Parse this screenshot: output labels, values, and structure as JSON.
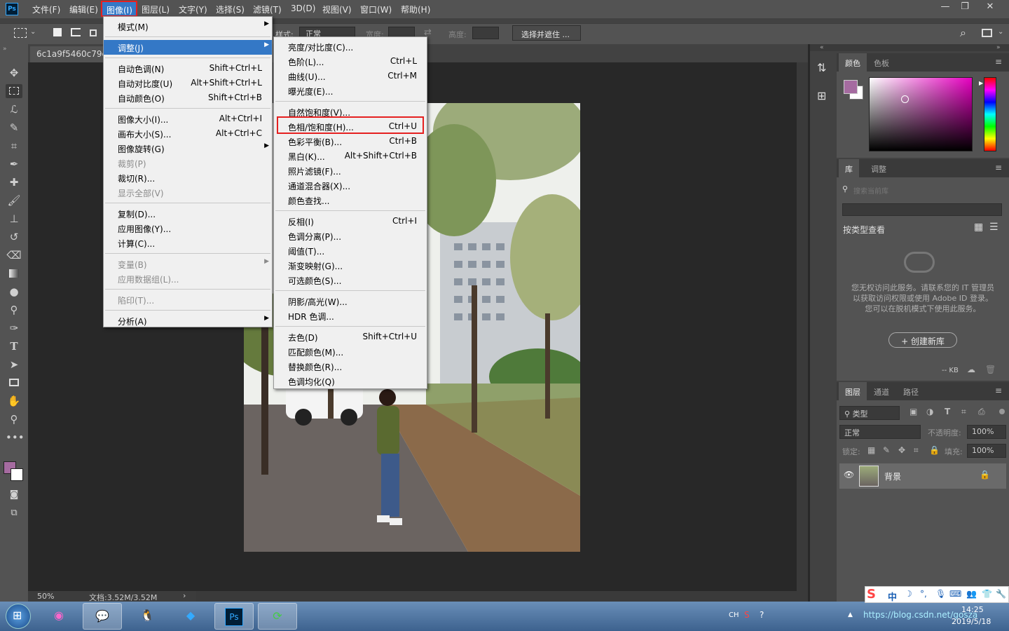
{
  "menubar": {
    "logo": "Ps",
    "items": [
      "文件(F)",
      "编辑(E)",
      "图像(I)",
      "图层(L)",
      "文字(Y)",
      "选择(S)",
      "滤镜(T)",
      "3D(D)",
      "视图(V)",
      "窗口(W)",
      "帮助(H)"
    ],
    "window_controls": [
      "—",
      "❐",
      "✕"
    ]
  },
  "options_bar": {
    "style_label": "样式:",
    "style_value": "正常",
    "width_label": "宽度:",
    "height_label": "高度:",
    "select_mask_button": "选择并遮住 ..."
  },
  "document": {
    "tab_title": "6c1a9f5460c79c",
    "zoom": "50%",
    "doc_info": "文档:3.52M/3.52M"
  },
  "image_menu": {
    "items": [
      {
        "label": "模式(M)",
        "shortcut": "",
        "submenu": true,
        "disabled": false
      },
      {
        "label": "调整(J)",
        "shortcut": "",
        "submenu": true,
        "disabled": false,
        "highlighted": true
      },
      {
        "label": "自动色调(N)",
        "shortcut": "Shift+Ctrl+L"
      },
      {
        "label": "自动对比度(U)",
        "shortcut": "Alt+Shift+Ctrl+L"
      },
      {
        "label": "自动颜色(O)",
        "shortcut": "Shift+Ctrl+B"
      },
      {
        "label": "图像大小(I)...",
        "shortcut": "Alt+Ctrl+I"
      },
      {
        "label": "画布大小(S)...",
        "shortcut": "Alt+Ctrl+C"
      },
      {
        "label": "图像旋转(G)",
        "shortcut": "",
        "submenu": true
      },
      {
        "label": "裁剪(P)",
        "shortcut": "",
        "disabled": true
      },
      {
        "label": "裁切(R)...",
        "shortcut": ""
      },
      {
        "label": "显示全部(V)",
        "shortcut": "",
        "disabled": true
      },
      {
        "label": "复制(D)...",
        "shortcut": ""
      },
      {
        "label": "应用图像(Y)...",
        "shortcut": ""
      },
      {
        "label": "计算(C)...",
        "shortcut": ""
      },
      {
        "label": "变量(B)",
        "shortcut": "",
        "submenu": true,
        "disabled": true
      },
      {
        "label": "应用数据组(L)...",
        "shortcut": "",
        "disabled": true
      },
      {
        "label": "陷印(T)...",
        "shortcut": "",
        "disabled": true
      },
      {
        "label": "分析(A)",
        "shortcut": "",
        "submenu": true
      }
    ]
  },
  "adjust_menu": {
    "items": [
      {
        "label": "亮度/对比度(C)...",
        "shortcut": ""
      },
      {
        "label": "色阶(L)...",
        "shortcut": "Ctrl+L"
      },
      {
        "label": "曲线(U)...",
        "shortcut": "Ctrl+M"
      },
      {
        "label": "曝光度(E)...",
        "shortcut": ""
      },
      {
        "label": "自然饱和度(V)...",
        "shortcut": ""
      },
      {
        "label": "色相/饱和度(H)...",
        "shortcut": "Ctrl+U",
        "boxed": true
      },
      {
        "label": "色彩平衡(B)...",
        "shortcut": "Ctrl+B"
      },
      {
        "label": "黑白(K)...",
        "shortcut": "Alt+Shift+Ctrl+B"
      },
      {
        "label": "照片滤镜(F)...",
        "shortcut": ""
      },
      {
        "label": "通道混合器(X)...",
        "shortcut": ""
      },
      {
        "label": "颜色查找...",
        "shortcut": ""
      },
      {
        "label": "反相(I)",
        "shortcut": "Ctrl+I"
      },
      {
        "label": "色调分离(P)...",
        "shortcut": ""
      },
      {
        "label": "阈值(T)...",
        "shortcut": ""
      },
      {
        "label": "渐变映射(G)...",
        "shortcut": ""
      },
      {
        "label": "可选颜色(S)...",
        "shortcut": ""
      },
      {
        "label": "阴影/高光(W)...",
        "shortcut": ""
      },
      {
        "label": "HDR 色调...",
        "shortcut": ""
      },
      {
        "label": "去色(D)",
        "shortcut": "Shift+Ctrl+U"
      },
      {
        "label": "匹配颜色(M)...",
        "shortcut": ""
      },
      {
        "label": "替换颜色(R)...",
        "shortcut": ""
      },
      {
        "label": "色调均化(Q)",
        "shortcut": ""
      }
    ]
  },
  "color_panel": {
    "tabs": [
      "颜色",
      "色板"
    ],
    "foreground": "#a56ba0",
    "background": "#ffffff",
    "hue_color": "#e600c0"
  },
  "library_panel": {
    "tabs": [
      "库",
      "调整"
    ],
    "search_placeholder": "搜索当前库",
    "view_by": "按类型查看",
    "message": "您无权访问此服务。请联系您的 IT 管理员以获取访问权限或使用 Adobe ID 登录。您可以在脱机模式下使用此服务。",
    "create_button": "+ 创建新库",
    "size": "-- KB"
  },
  "layers_panel": {
    "tabs": [
      "图层",
      "通道",
      "路径"
    ],
    "filter_label": "类型",
    "blend_mode": "正常",
    "opacity_label": "不透明度:",
    "opacity_value": "100%",
    "lock_label": "锁定:",
    "fill_label": "填充:",
    "fill_value": "100%",
    "layers": [
      {
        "name": "背景",
        "locked": true,
        "visible": true
      }
    ]
  },
  "taskbar": {
    "time": "14:25",
    "date": "2019/5/18",
    "lang": "CH",
    "ime": "中",
    "ps_label": "Ps",
    "watermark": "https://blog.csdn.net/gosza"
  }
}
